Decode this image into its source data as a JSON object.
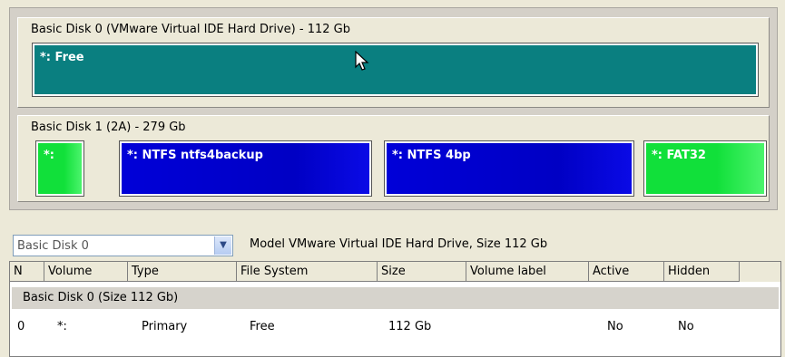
{
  "disks": [
    {
      "title": "Basic Disk 0 (VMware Virtual IDE Hard Drive) - 112 Gb",
      "partitions": [
        {
          "label": "*: Free",
          "color": "#0a7f80"
        }
      ]
    },
    {
      "title": "Basic Disk 1 (2A) - 279 Gb",
      "partitions": [
        {
          "label": "*:",
          "color": "#11e03a"
        },
        {
          "label": "*: NTFS ntfs4backup",
          "color": "#0000d0"
        },
        {
          "label": "*: NTFS 4bp",
          "color": "#0000d0"
        },
        {
          "label": "*: FAT32",
          "color": "#11e03a"
        }
      ]
    }
  ],
  "selector": {
    "value": "Basic Disk 0",
    "model_info": "Model VMware Virtual IDE Hard Drive, Size 112 Gb"
  },
  "table": {
    "columns": [
      "N",
      "Volume",
      "Type",
      "File System",
      "Size",
      "Volume label",
      "Active",
      "Hidden"
    ],
    "group_label": "Basic Disk 0 (Size 112 Gb)",
    "rows": [
      {
        "n": "0",
        "volume": "*:",
        "type": "Primary",
        "file_system": "Free",
        "size": "112 Gb",
        "volume_label": "",
        "active": "No",
        "hidden": "No"
      }
    ]
  },
  "colors": {
    "free": "#0a7f80",
    "ntfs": "#0000d0",
    "fat": "#11e03a",
    "window_bg": "#ece9d8"
  }
}
